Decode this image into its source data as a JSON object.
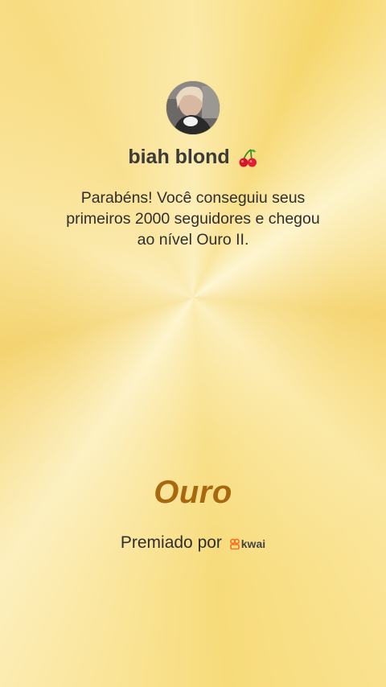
{
  "profile": {
    "username": "biah blond",
    "username_emoji": "cherry-icon"
  },
  "message": {
    "line1": "Parabéns! Você conseguiu seus",
    "line2": "primeiros 2000 seguidores e chegou",
    "line3": "ao nível Ouro II."
  },
  "level": {
    "name": "Ouro"
  },
  "footer": {
    "awarded_by": "Premiado por",
    "brand": "kwai"
  },
  "colors": {
    "level_text": "#a8680e",
    "brand_orange": "#ff6a1a",
    "text": "#2e2e2e"
  }
}
